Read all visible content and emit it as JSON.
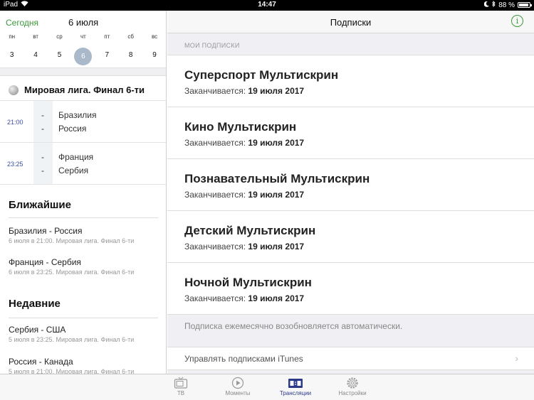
{
  "status": {
    "carrier": "iPad",
    "time": "14:47",
    "battery": "88 %"
  },
  "calendar": {
    "today_label": "Сегодня",
    "date_label": "6 июля",
    "weekdays": [
      "пн",
      "вт",
      "ср",
      "чт",
      "пт",
      "сб",
      "вс"
    ],
    "days": [
      "3",
      "4",
      "5",
      "6",
      "7",
      "8",
      "9"
    ],
    "selected_index": 3
  },
  "league": {
    "name": "Мировая лига. Финал 6-ти"
  },
  "matches": [
    {
      "time": "21:00",
      "team1": "Бразилия",
      "team2": "Россия",
      "score1": "-",
      "score2": "-"
    },
    {
      "time": "23:25",
      "team1": "Франция",
      "team2": "Сербия",
      "score1": "-",
      "score2": "-"
    }
  ],
  "upcoming": {
    "title": "Ближайшие",
    "items": [
      {
        "title": "Бразилия - Россия",
        "sub": "6 июля в 21:00. Мировая лига. Финал 6-ти"
      },
      {
        "title": "Франция - Сербия",
        "sub": "6 июля в 23:25. Мировая лига. Финал 6-ти"
      }
    ]
  },
  "recent": {
    "title": "Недавние",
    "items": [
      {
        "title": "Сербия - США",
        "sub": "5 июля в 23:25. Мировая лига. Финал 6-ти"
      },
      {
        "title": "Россия - Канада",
        "sub": "5 июля в 21:00. Мировая лига. Финал 6-ти"
      }
    ]
  },
  "right": {
    "nav_title": "Подписки",
    "info_glyph": "i",
    "group_label": "МОИ ПОДПИСКИ",
    "expires_prefix": "Заканчивается: ",
    "subscriptions": [
      {
        "name": "Суперспорт Мультискрин",
        "expires": "19 июля 2017"
      },
      {
        "name": "Кино Мультискрин",
        "expires": "19 июля 2017"
      },
      {
        "name": "Познавательный Мультискрин",
        "expires": "19 июля 2017"
      },
      {
        "name": "Детский Мультискрин",
        "expires": "19 июля 2017"
      },
      {
        "name": "Ночной Мультискрин",
        "expires": "19 июля 2017"
      }
    ],
    "note": "Подписка ежемесячно возобновляется автоматически.",
    "manage_label": "Управлять подписками iTunes"
  },
  "tabs": [
    {
      "label": "ТВ",
      "icon": "tv-icon",
      "active": false
    },
    {
      "label": "Моменты",
      "icon": "play-icon",
      "active": false
    },
    {
      "label": "Трансляции",
      "icon": "scoreboard-icon",
      "active": true
    },
    {
      "label": "Настройки",
      "icon": "gear-icon",
      "active": false
    }
  ],
  "colors": {
    "accent_green": "#3a9a3a",
    "active_tab": "#2d3a8c",
    "selected_day": "#a9b9c9"
  }
}
